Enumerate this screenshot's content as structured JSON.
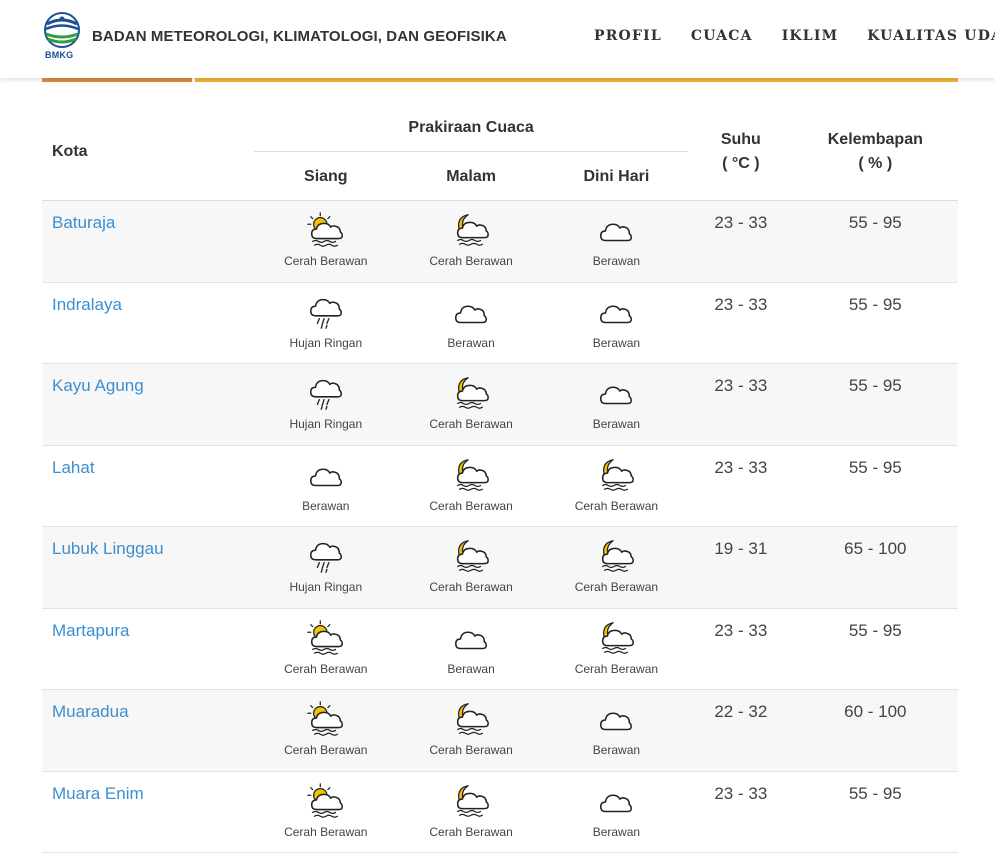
{
  "header": {
    "logo_text": "BMKG",
    "agency_name": "BADAN METEOROLOGI, KLIMATOLOGI, DAN GEOFISIKA",
    "nav": [
      "PROFIL",
      "CUACA",
      "IKLIM",
      "KUALITAS UDARA"
    ]
  },
  "table": {
    "col_city": "Kota",
    "col_forecast": "Prakiraan Cuaca",
    "col_siang": "Siang",
    "col_malam": "Malam",
    "col_dini": "Dini Hari",
    "col_suhu_line1": "Suhu",
    "col_suhu_line2": "( °C )",
    "col_kel_line1": "Kelembapan",
    "col_kel_line2": "( % )",
    "rows": [
      {
        "city": "Baturaja",
        "siang": "Cerah Berawan",
        "siang_icon": "sun-cloud-icon",
        "malam": "Cerah Berawan",
        "malam_icon": "moon-cloud-icon",
        "dini": "Berawan",
        "dini_icon": "cloud-icon",
        "suhu": "23 - 33",
        "kel": "55 - 95"
      },
      {
        "city": "Indralaya",
        "siang": "Hujan Ringan",
        "siang_icon": "rain-cloud-icon",
        "malam": "Berawan",
        "malam_icon": "cloud-icon",
        "dini": "Berawan",
        "dini_icon": "cloud-icon",
        "suhu": "23 - 33",
        "kel": "55 - 95"
      },
      {
        "city": "Kayu Agung",
        "siang": "Hujan Ringan",
        "siang_icon": "rain-cloud-icon",
        "malam": "Cerah Berawan",
        "malam_icon": "moon-cloud-icon",
        "dini": "Berawan",
        "dini_icon": "cloud-icon",
        "suhu": "23 - 33",
        "kel": "55 - 95"
      },
      {
        "city": "Lahat",
        "siang": "Berawan",
        "siang_icon": "cloud-icon",
        "malam": "Cerah Berawan",
        "malam_icon": "moon-cloud-icon",
        "dini": "Cerah Berawan",
        "dini_icon": "moon-cloud-icon",
        "suhu": "23 - 33",
        "kel": "55 - 95"
      },
      {
        "city": "Lubuk Linggau",
        "siang": "Hujan Ringan",
        "siang_icon": "rain-cloud-icon",
        "malam": "Cerah Berawan",
        "malam_icon": "moon-cloud-icon",
        "dini": "Cerah Berawan",
        "dini_icon": "moon-cloud-icon",
        "suhu": "19 - 31",
        "kel": "65 - 100"
      },
      {
        "city": "Martapura",
        "siang": "Cerah Berawan",
        "siang_icon": "sun-cloud-icon",
        "malam": "Berawan",
        "malam_icon": "cloud-icon",
        "dini": "Cerah Berawan",
        "dini_icon": "moon-cloud-icon",
        "suhu": "23 - 33",
        "kel": "55 - 95"
      },
      {
        "city": "Muaradua",
        "siang": "Cerah Berawan",
        "siang_icon": "sun-cloud-icon",
        "malam": "Cerah Berawan",
        "malam_icon": "moon-cloud-icon",
        "dini": "Berawan",
        "dini_icon": "cloud-icon",
        "suhu": "22 - 32",
        "kel": "60 - 100"
      },
      {
        "city": "Muara Enim",
        "siang": "Cerah Berawan",
        "siang_icon": "sun-cloud-icon",
        "malam": "Cerah Berawan",
        "malam_icon": "moon-cloud-icon",
        "dini": "Berawan",
        "dini_icon": "cloud-icon",
        "suhu": "23 - 33",
        "kel": "55 - 95"
      }
    ]
  },
  "colors": {
    "link": "#3b8fd1",
    "accent_orange": "#e08a3c",
    "accent_yellow": "#f0b43a",
    "icon_yellow": "#f5c400"
  }
}
